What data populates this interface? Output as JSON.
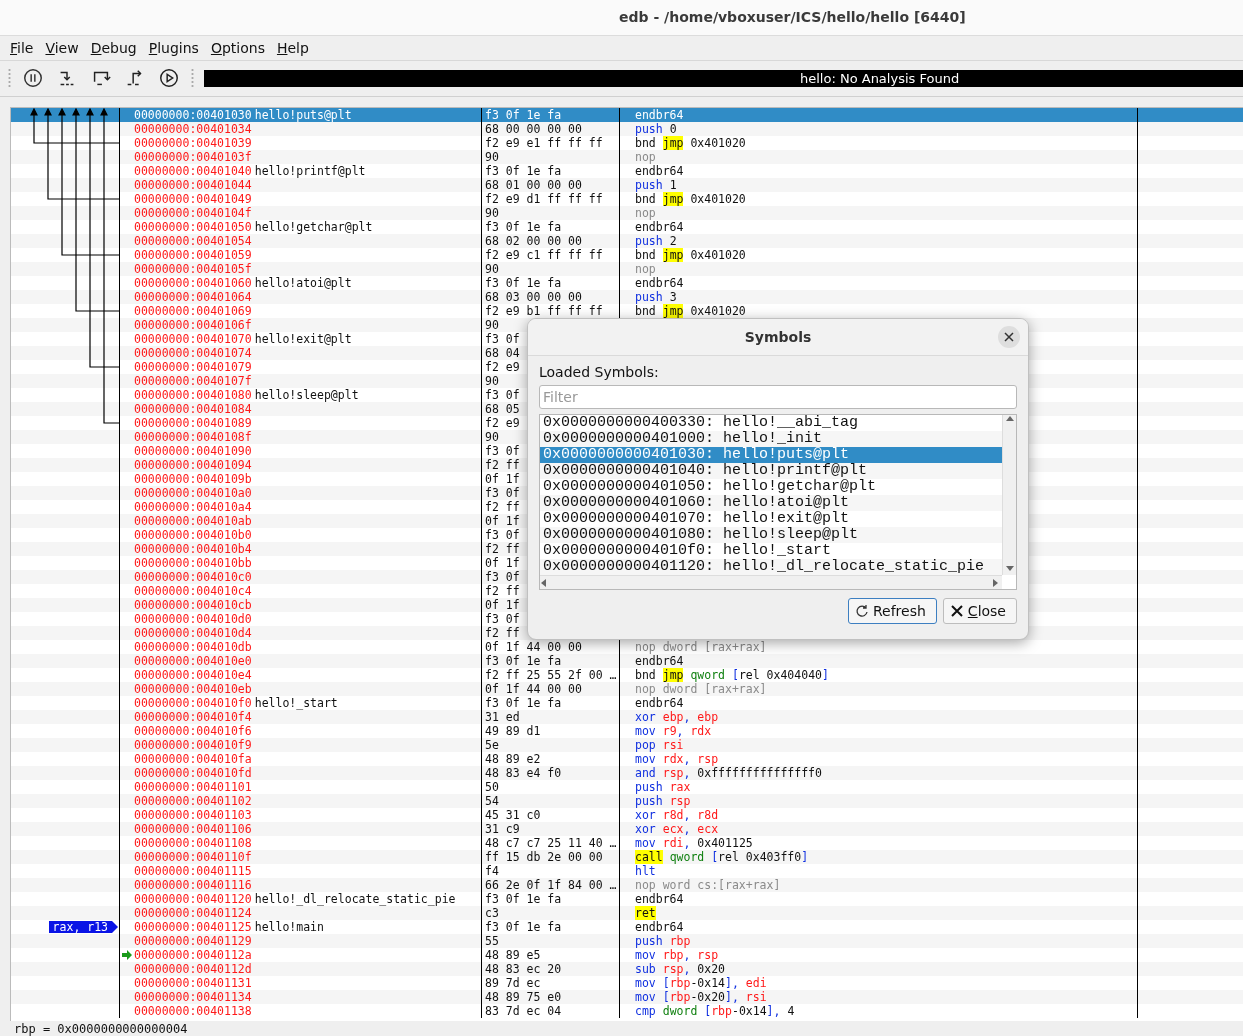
{
  "window": {
    "title": "edb - /home/vboxuser/ICS/hello/hello [6440]"
  },
  "menu": [
    "File",
    "View",
    "Debug",
    "Plugins",
    "Options",
    "Help"
  ],
  "status": "hello: No Analysis Found",
  "rows": [
    {
      "address": "00000000:00401030",
      "symbol": "hello!puts@plt",
      "bytes": "f3 0f 1e fa",
      "instruction": [
        {
          "kind": "plain",
          "text": "endbr64"
        }
      ],
      "selected": true,
      "current": false
    },
    {
      "address": "00000000:00401034",
      "bytes": "68 00 00 00 00",
      "instruction": [
        {
          "kind": "op",
          "text": "push "
        },
        {
          "kind": "plain",
          "text": "0"
        }
      ],
      "selected": false,
      "current": false
    },
    {
      "address": "00000000:00401039",
      "bytes": "f2 e9 e1 ff ff ff",
      "instruction": [
        {
          "kind": "plain",
          "text": "bnd "
        },
        {
          "kind": "hl",
          "text": "jmp"
        },
        {
          "kind": "plain",
          "text": " 0x401020"
        }
      ],
      "selected": false,
      "current": false
    },
    {
      "address": "00000000:0040103f",
      "bytes": "90",
      "instruction": [
        {
          "kind": "dim",
          "text": "nop"
        }
      ],
      "selected": false,
      "current": false
    },
    {
      "address": "00000000:00401040",
      "symbol": "hello!printf@plt",
      "bytes": "f3 0f 1e fa",
      "instruction": [
        {
          "kind": "plain",
          "text": "endbr64"
        }
      ],
      "selected": false,
      "current": false
    },
    {
      "address": "00000000:00401044",
      "bytes": "68 01 00 00 00",
      "instruction": [
        {
          "kind": "op",
          "text": "push "
        },
        {
          "kind": "plain",
          "text": "1"
        }
      ],
      "selected": false,
      "current": false
    },
    {
      "address": "00000000:00401049",
      "bytes": "f2 e9 d1 ff ff ff",
      "instruction": [
        {
          "kind": "plain",
          "text": "bnd "
        },
        {
          "kind": "hl",
          "text": "jmp"
        },
        {
          "kind": "plain",
          "text": " 0x401020"
        }
      ],
      "selected": false,
      "current": false
    },
    {
      "address": "00000000:0040104f",
      "bytes": "90",
      "instruction": [
        {
          "kind": "dim",
          "text": "nop"
        }
      ],
      "selected": false,
      "current": false
    },
    {
      "address": "00000000:00401050",
      "symbol": "hello!getchar@plt",
      "bytes": "f3 0f 1e fa",
      "instruction": [
        {
          "kind": "plain",
          "text": "endbr64"
        }
      ],
      "selected": false,
      "current": false
    },
    {
      "address": "00000000:00401054",
      "bytes": "68 02 00 00 00",
      "instruction": [
        {
          "kind": "op",
          "text": "push "
        },
        {
          "kind": "plain",
          "text": "2"
        }
      ],
      "selected": false,
      "current": false
    },
    {
      "address": "00000000:00401059",
      "bytes": "f2 e9 c1 ff ff ff",
      "instruction": [
        {
          "kind": "plain",
          "text": "bnd "
        },
        {
          "kind": "hl",
          "text": "jmp"
        },
        {
          "kind": "plain",
          "text": " 0x401020"
        }
      ],
      "selected": false,
      "current": false
    },
    {
      "address": "00000000:0040105f",
      "bytes": "90",
      "instruction": [
        {
          "kind": "dim",
          "text": "nop"
        }
      ],
      "selected": false,
      "current": false
    },
    {
      "address": "00000000:00401060",
      "symbol": "hello!atoi@plt",
      "bytes": "f3 0f 1e fa",
      "instruction": [
        {
          "kind": "plain",
          "text": "endbr64"
        }
      ],
      "selected": false,
      "current": false
    },
    {
      "address": "00000000:00401064",
      "bytes": "68 03 00 00 00",
      "instruction": [
        {
          "kind": "op",
          "text": "push "
        },
        {
          "kind": "plain",
          "text": "3"
        }
      ],
      "selected": false,
      "current": false
    },
    {
      "address": "00000000:00401069",
      "bytes": "f2 e9 b1 ff ff ff",
      "instruction": [
        {
          "kind": "plain",
          "text": "bnd "
        },
        {
          "kind": "hl",
          "text": "jmp"
        },
        {
          "kind": "plain",
          "text": " 0x401020"
        }
      ],
      "selected": false,
      "current": false
    },
    {
      "address": "00000000:0040106f",
      "bytes": "90",
      "selected": false,
      "current": false
    },
    {
      "address": "00000000:00401070",
      "symbol": "hello!exit@plt",
      "bytes": "f3 0f",
      "selected": false,
      "current": false
    },
    {
      "address": "00000000:00401074",
      "bytes": "68 04",
      "selected": false,
      "current": false
    },
    {
      "address": "00000000:00401079",
      "bytes": "f2 e9",
      "selected": false,
      "current": false
    },
    {
      "address": "00000000:0040107f",
      "bytes": "90",
      "selected": false,
      "current": false
    },
    {
      "address": "00000000:00401080",
      "symbol": "hello!sleep@plt",
      "bytes": "f3 0f",
      "selected": false,
      "current": false
    },
    {
      "address": "00000000:00401084",
      "bytes": "68 05",
      "selected": false,
      "current": false
    },
    {
      "address": "00000000:00401089",
      "bytes": "f2 e9",
      "selected": false,
      "current": false
    },
    {
      "address": "00000000:0040108f",
      "bytes": "90",
      "selected": false,
      "current": false
    },
    {
      "address": "00000000:00401090",
      "bytes": "f3 0f",
      "selected": false,
      "current": false
    },
    {
      "address": "00000000:00401094",
      "bytes": "f2 ff",
      "selected": false,
      "current": false
    },
    {
      "address": "00000000:0040109b",
      "bytes": "0f 1f",
      "selected": false,
      "current": false
    },
    {
      "address": "00000000:004010a0",
      "bytes": "f3 0f",
      "selected": false,
      "current": false
    },
    {
      "address": "00000000:004010a4",
      "bytes": "f2 ff",
      "selected": false,
      "current": false
    },
    {
      "address": "00000000:004010ab",
      "bytes": "0f 1f",
      "selected": false,
      "current": false
    },
    {
      "address": "00000000:004010b0",
      "bytes": "f3 0f",
      "selected": false,
      "current": false
    },
    {
      "address": "00000000:004010b4",
      "bytes": "f2 ff",
      "selected": false,
      "current": false
    },
    {
      "address": "00000000:004010bb",
      "bytes": "0f 1f",
      "selected": false,
      "current": false
    },
    {
      "address": "00000000:004010c0",
      "bytes": "f3 0f",
      "selected": false,
      "current": false
    },
    {
      "address": "00000000:004010c4",
      "bytes": "f2 ff",
      "selected": false,
      "current": false
    },
    {
      "address": "00000000:004010cb",
      "bytes": "0f 1f",
      "selected": false,
      "current": false
    },
    {
      "address": "00000000:004010d0",
      "bytes": "f3 0f",
      "selected": false,
      "current": false
    },
    {
      "address": "00000000:004010d4",
      "bytes": "f2 ff",
      "selected": false,
      "current": false
    },
    {
      "address": "00000000:004010db",
      "bytes": "0f 1f 44 00 00",
      "instruction": [
        {
          "kind": "dim",
          "text": "nop dword [rax+rax]"
        }
      ],
      "selected": false,
      "current": false
    },
    {
      "address": "00000000:004010e0",
      "bytes": "f3 0f 1e fa",
      "instruction": [
        {
          "kind": "plain",
          "text": "endbr64"
        }
      ],
      "selected": false,
      "current": false
    },
    {
      "address": "00000000:004010e4",
      "bytes": "f2 ff 25 55 2f 00 …",
      "instruction": [
        {
          "kind": "plain",
          "text": "bnd "
        },
        {
          "kind": "hl",
          "text": "jmp"
        },
        {
          "kind": "size",
          "text": " qword"
        },
        {
          "kind": "punct",
          "text": " ["
        },
        {
          "kind": "plain",
          "text": "rel 0x404040"
        },
        {
          "kind": "punct",
          "text": "]"
        }
      ],
      "selected": false,
      "current": false
    },
    {
      "address": "00000000:004010eb",
      "bytes": "0f 1f 44 00 00",
      "instruction": [
        {
          "kind": "dim",
          "text": "nop dword [rax+rax]"
        }
      ],
      "selected": false,
      "current": false
    },
    {
      "address": "00000000:004010f0",
      "symbol": "hello!_start",
      "bytes": "f3 0f 1e fa",
      "instruction": [
        {
          "kind": "plain",
          "text": "endbr64"
        }
      ],
      "selected": false,
      "current": false
    },
    {
      "address": "00000000:004010f4",
      "bytes": "31 ed",
      "instruction": [
        {
          "kind": "op",
          "text": "xor "
        },
        {
          "kind": "reg",
          "text": "ebp"
        },
        {
          "kind": "punct",
          "text": ", "
        },
        {
          "kind": "reg",
          "text": "ebp"
        }
      ],
      "selected": false,
      "current": false
    },
    {
      "address": "00000000:004010f6",
      "bytes": "49 89 d1",
      "instruction": [
        {
          "kind": "op",
          "text": "mov "
        },
        {
          "kind": "reg",
          "text": "r9"
        },
        {
          "kind": "punct",
          "text": ", "
        },
        {
          "kind": "reg",
          "text": "rdx"
        }
      ],
      "selected": false,
      "current": false
    },
    {
      "address": "00000000:004010f9",
      "bytes": "5e",
      "instruction": [
        {
          "kind": "op",
          "text": "pop "
        },
        {
          "kind": "reg",
          "text": "rsi"
        }
      ],
      "selected": false,
      "current": false
    },
    {
      "address": "00000000:004010fa",
      "bytes": "48 89 e2",
      "instruction": [
        {
          "kind": "op",
          "text": "mov "
        },
        {
          "kind": "reg",
          "text": "rdx"
        },
        {
          "kind": "punct",
          "text": ", "
        },
        {
          "kind": "reg",
          "text": "rsp"
        }
      ],
      "selected": false,
      "current": false
    },
    {
      "address": "00000000:004010fd",
      "bytes": "48 83 e4 f0",
      "instruction": [
        {
          "kind": "op",
          "text": "and "
        },
        {
          "kind": "reg",
          "text": "rsp"
        },
        {
          "kind": "punct",
          "text": ", "
        },
        {
          "kind": "plain",
          "text": "0xfffffffffffffff0"
        }
      ],
      "selected": false,
      "current": false
    },
    {
      "address": "00000000:00401101",
      "bytes": "50",
      "instruction": [
        {
          "kind": "op",
          "text": "push "
        },
        {
          "kind": "reg",
          "text": "rax"
        }
      ],
      "selected": false,
      "current": false
    },
    {
      "address": "00000000:00401102",
      "bytes": "54",
      "instruction": [
        {
          "kind": "op",
          "text": "push "
        },
        {
          "kind": "reg",
          "text": "rsp"
        }
      ],
      "selected": false,
      "current": false
    },
    {
      "address": "00000000:00401103",
      "bytes": "45 31 c0",
      "instruction": [
        {
          "kind": "op",
          "text": "xor "
        },
        {
          "kind": "reg",
          "text": "r8d"
        },
        {
          "kind": "punct",
          "text": ", "
        },
        {
          "kind": "reg",
          "text": "r8d"
        }
      ],
      "selected": false,
      "current": false
    },
    {
      "address": "00000000:00401106",
      "bytes": "31 c9",
      "instruction": [
        {
          "kind": "op",
          "text": "xor "
        },
        {
          "kind": "reg",
          "text": "ecx"
        },
        {
          "kind": "punct",
          "text": ", "
        },
        {
          "kind": "reg",
          "text": "ecx"
        }
      ],
      "selected": false,
      "current": false
    },
    {
      "address": "00000000:00401108",
      "bytes": "48 c7 c7 25 11 40 …",
      "instruction": [
        {
          "kind": "op",
          "text": "mov "
        },
        {
          "kind": "reg",
          "text": "rdi"
        },
        {
          "kind": "punct",
          "text": ", "
        },
        {
          "kind": "plain",
          "text": "0x401125"
        }
      ],
      "selected": false,
      "current": false
    },
    {
      "address": "00000000:0040110f",
      "bytes": "ff 15 db 2e 00 00",
      "instruction": [
        {
          "kind": "hl",
          "text": "call"
        },
        {
          "kind": "size",
          "text": " qword"
        },
        {
          "kind": "punct",
          "text": " ["
        },
        {
          "kind": "plain",
          "text": "rel 0x403ff0"
        },
        {
          "kind": "punct",
          "text": "]"
        }
      ],
      "selected": false,
      "current": false
    },
    {
      "address": "00000000:00401115",
      "bytes": "f4",
      "instruction": [
        {
          "kind": "op",
          "text": "hlt"
        }
      ],
      "selected": false,
      "current": false
    },
    {
      "address": "00000000:00401116",
      "bytes": "66 2e 0f 1f 84 00 …",
      "instruction": [
        {
          "kind": "dim",
          "text": "nop word cs:[rax+rax]"
        }
      ],
      "selected": false,
      "current": false
    },
    {
      "address": "00000000:00401120",
      "symbol": "hello!_dl_relocate_static_pie",
      "bytes": "f3 0f 1e fa",
      "instruction": [
        {
          "kind": "plain",
          "text": "endbr64"
        }
      ],
      "selected": false,
      "current": false
    },
    {
      "address": "00000000:00401124",
      "bytes": "c3",
      "instruction": [
        {
          "kind": "hl",
          "text": "ret"
        }
      ],
      "selected": false,
      "current": false
    },
    {
      "address": "00000000:00401125",
      "symbol": "hello!main",
      "register_tag": "rax, r13",
      "bytes": "f3 0f 1e fa",
      "instruction": [
        {
          "kind": "plain",
          "text": "endbr64"
        }
      ],
      "selected": false,
      "current": false
    },
    {
      "address": "00000000:00401129",
      "bytes": "55",
      "instruction": [
        {
          "kind": "op",
          "text": "push "
        },
        {
          "kind": "reg",
          "text": "rbp"
        }
      ],
      "selected": false,
      "current": false
    },
    {
      "address": "00000000:0040112a",
      "bytes": "48 89 e5",
      "instruction": [
        {
          "kind": "op",
          "text": "mov "
        },
        {
          "kind": "reg",
          "text": "rbp"
        },
        {
          "kind": "punct",
          "text": ", "
        },
        {
          "kind": "reg",
          "text": "rsp"
        }
      ],
      "selected": false,
      "current": true
    },
    {
      "address": "00000000:0040112d",
      "bytes": "48 83 ec 20",
      "instruction": [
        {
          "kind": "op",
          "text": "sub "
        },
        {
          "kind": "reg",
          "text": "rsp"
        },
        {
          "kind": "punct",
          "text": ", "
        },
        {
          "kind": "plain",
          "text": "0x20"
        }
      ],
      "selected": false,
      "current": false
    },
    {
      "address": "00000000:00401131",
      "bytes": "89 7d ec",
      "instruction": [
        {
          "kind": "op",
          "text": "mov "
        },
        {
          "kind": "punct",
          "text": "["
        },
        {
          "kind": "reg",
          "text": "rbp"
        },
        {
          "kind": "plain",
          "text": "-0x14"
        },
        {
          "kind": "punct",
          "text": "], "
        },
        {
          "kind": "reg",
          "text": "edi"
        }
      ],
      "selected": false,
      "current": false
    },
    {
      "address": "00000000:00401134",
      "bytes": "48 89 75 e0",
      "instruction": [
        {
          "kind": "op",
          "text": "mov "
        },
        {
          "kind": "punct",
          "text": "["
        },
        {
          "kind": "reg",
          "text": "rbp"
        },
        {
          "kind": "plain",
          "text": "-0x20"
        },
        {
          "kind": "punct",
          "text": "], "
        },
        {
          "kind": "reg",
          "text": "rsi"
        }
      ],
      "selected": false,
      "current": false
    },
    {
      "address": "00000000:00401138",
      "bytes": "83 7d ec 04",
      "instruction": [
        {
          "kind": "op",
          "text": "cmp "
        },
        {
          "kind": "size",
          "text": "dword"
        },
        {
          "kind": "punct",
          "text": " ["
        },
        {
          "kind": "reg",
          "text": "rbp"
        },
        {
          "kind": "plain",
          "text": "-0x14"
        },
        {
          "kind": "punct",
          "text": "], "
        },
        {
          "kind": "plain",
          "text": "4"
        }
      ],
      "selected": false,
      "current": false
    }
  ],
  "register_line": "rbp = 0x0000000000000004",
  "dialog": {
    "title": "Symbols",
    "label": "Loaded Symbols:",
    "filter": {
      "placeholder": "Filter"
    },
    "symbols": [
      {
        "text": "0x0000000000400330: hello!__abi_tag",
        "selected": false
      },
      {
        "text": "0x0000000000401000: hello!_init",
        "selected": false
      },
      {
        "text": "0x0000000000401030: hello!puts@plt",
        "selected": true
      },
      {
        "text": "0x0000000000401040: hello!printf@plt",
        "selected": false
      },
      {
        "text": "0x0000000000401050: hello!getchar@plt",
        "selected": false
      },
      {
        "text": "0x0000000000401060: hello!atoi@plt",
        "selected": false
      },
      {
        "text": "0x0000000000401070: hello!exit@plt",
        "selected": false
      },
      {
        "text": "0x0000000000401080: hello!sleep@plt",
        "selected": false
      },
      {
        "text": "0x00000000004010f0: hello!_start",
        "selected": false
      },
      {
        "text": "0x0000000000401120: hello!_dl_relocate_static_pie",
        "selected": false
      }
    ],
    "buttons": [
      {
        "label": "Refresh",
        "kind": "refresh"
      },
      {
        "label": "Close",
        "kind": "close"
      }
    ]
  }
}
